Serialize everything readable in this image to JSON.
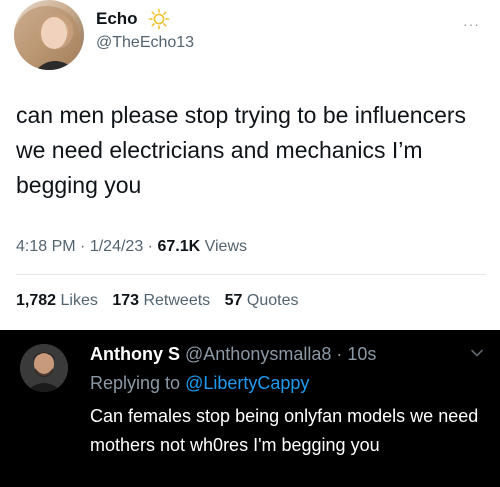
{
  "tweet": {
    "author_name": "Echo",
    "author_handle": "@TheEcho13",
    "text": "can men please stop trying to be influencers we need electricians and mechanics I’m begging you",
    "time": "4:18 PM",
    "date": "1/24/23",
    "views_count": "67.1K",
    "views_label": "Views",
    "separator": "·",
    "more_menu": "···",
    "stats": {
      "likes_count": "1,782",
      "likes_label": "Likes",
      "retweets_count": "173",
      "retweets_label": "Retweets",
      "quotes_count": "57",
      "quotes_label": "Quotes"
    },
    "icons": {
      "badge": "sun-icon",
      "menu": "more-icon"
    }
  },
  "reply": {
    "author_name": "Anthony S",
    "author_handle": "@Anthonysmalla8",
    "separator": "·",
    "time": "10s",
    "replying_label": "Replying to",
    "replying_handle": "@LibertyCappy",
    "text": "Can females stop being onlyfan models we need mothers not wh0res I'm begging you",
    "icons": {
      "menu": "chevron-down-icon"
    }
  },
  "colors": {
    "light_bg": "#ffffff",
    "dark_bg": "#000000",
    "primary_text": "#0f1419",
    "secondary_text": "#536471",
    "dark_secondary_text": "#8b98a5",
    "link": "#1d9bf0",
    "badge": "#f2c230"
  }
}
